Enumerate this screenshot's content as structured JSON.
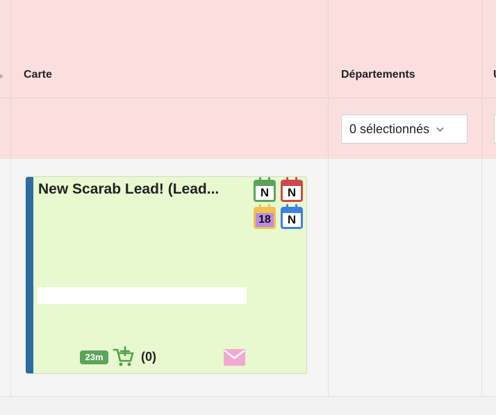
{
  "columns": [
    {
      "title": "Carte"
    },
    {
      "title": "Départements"
    },
    {
      "title": "U"
    }
  ],
  "filters": {
    "departements_select": "0 sélectionnés"
  },
  "card": {
    "title": "New Scarab Lead! (Lead...",
    "accent_color": "#2d6c9e",
    "background_color": "#e8f8cf",
    "calendars": [
      {
        "text": "N",
        "color": "#5ca45a",
        "icon": "calendar-icon"
      },
      {
        "text": "N",
        "color": "#d0484a",
        "icon": "calendar-icon"
      },
      {
        "text": "18",
        "color": "#f3c24e",
        "icon": "calendar-icon"
      },
      {
        "text": "N",
        "color": "#3b82e0",
        "icon": "calendar-icon"
      }
    ],
    "time_badge": "23m",
    "cart_icon": "cart-add-icon",
    "cart_count": "(0)",
    "mail_icon": "envelope-icon",
    "mail_color": "#f2a9cf"
  }
}
